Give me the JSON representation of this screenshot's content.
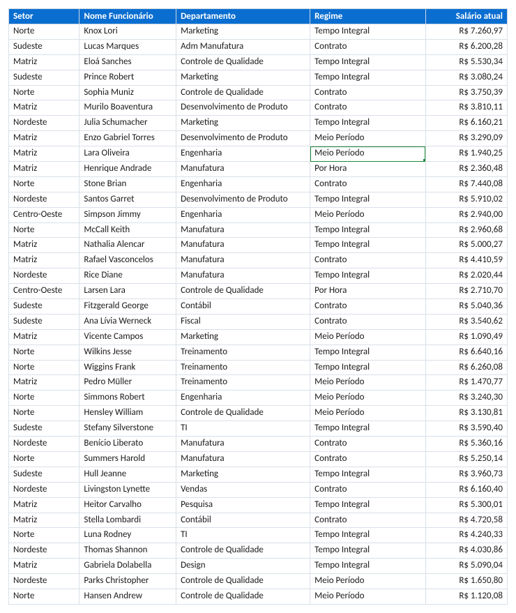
{
  "headers": {
    "setor": "Setor",
    "nome": "Nome Funcionário",
    "departamento": "Departamento",
    "regime": "Regime",
    "salario": "Salário atual"
  },
  "selected_cell": {
    "row_index": 8,
    "col_key": "regime"
  },
  "rows": [
    {
      "setor": "Norte",
      "nome": "Knox Lori",
      "departamento": "Marketing",
      "regime": "Tempo Integral",
      "salario": "R$ 7.260,97"
    },
    {
      "setor": "Sudeste",
      "nome": "Lucas Marques",
      "departamento": "Adm Manufatura",
      "regime": "Contrato",
      "salario": "R$ 6.200,28"
    },
    {
      "setor": "Matriz",
      "nome": "Eloá Sanches",
      "departamento": "Controle de Qualidade",
      "regime": "Tempo Integral",
      "salario": "R$ 5.530,34"
    },
    {
      "setor": "Sudeste",
      "nome": "Prince Robert",
      "departamento": "Marketing",
      "regime": "Tempo Integral",
      "salario": "R$ 3.080,24"
    },
    {
      "setor": "Norte",
      "nome": "Sophia Muniz",
      "departamento": "Controle de Qualidade",
      "regime": "Contrato",
      "salario": "R$ 3.750,39"
    },
    {
      "setor": "Matriz",
      "nome": "Murilo Boaventura",
      "departamento": "Desenvolvimento de Produto",
      "regime": "Contrato",
      "salario": "R$ 3.810,11"
    },
    {
      "setor": "Nordeste",
      "nome": "Julia Schumacher",
      "departamento": "Marketing",
      "regime": "Tempo Integral",
      "salario": "R$ 6.160,21"
    },
    {
      "setor": "Matriz",
      "nome": "Enzo Gabriel Torres",
      "departamento": "Desenvolvimento de Produto",
      "regime": "Meio Período",
      "salario": "R$ 3.290,09"
    },
    {
      "setor": "Matriz",
      "nome": "Lara Oliveira",
      "departamento": "Engenharia",
      "regime": "Meio Período",
      "salario": "R$ 1.940,25"
    },
    {
      "setor": "Matriz",
      "nome": "Henrique Andrade",
      "departamento": "Manufatura",
      "regime": "Por Hora",
      "salario": "R$ 2.360,48"
    },
    {
      "setor": "Norte",
      "nome": "Stone Brian",
      "departamento": "Engenharia",
      "regime": "Contrato",
      "salario": "R$ 7.440,08"
    },
    {
      "setor": "Nordeste",
      "nome": "Santos Garret",
      "departamento": "Desenvolvimento de Produto",
      "regime": "Tempo Integral",
      "salario": "R$ 5.910,02"
    },
    {
      "setor": "Centro-Oeste",
      "nome": "Simpson Jimmy",
      "departamento": "Engenharia",
      "regime": "Meio Período",
      "salario": "R$ 2.940,00"
    },
    {
      "setor": "Norte",
      "nome": "McCall Keith",
      "departamento": "Manufatura",
      "regime": "Tempo Integral",
      "salario": "R$ 2.960,68"
    },
    {
      "setor": "Matriz",
      "nome": "Nathalia Alencar",
      "departamento": "Manufatura",
      "regime": "Tempo Integral",
      "salario": "R$ 5.000,27"
    },
    {
      "setor": "Matriz",
      "nome": "Rafael Vasconcelos",
      "departamento": "Manufatura",
      "regime": "Contrato",
      "salario": "R$ 4.410,59"
    },
    {
      "setor": "Nordeste",
      "nome": "Rice Diane",
      "departamento": "Manufatura",
      "regime": "Tempo Integral",
      "salario": "R$ 2.020,44"
    },
    {
      "setor": "Centro-Oeste",
      "nome": "Larsen Lara",
      "departamento": "Controle de Qualidade",
      "regime": "Por Hora",
      "salario": "R$ 2.710,70"
    },
    {
      "setor": "Sudeste",
      "nome": "Fitzgerald George",
      "departamento": "Contábil",
      "regime": "Contrato",
      "salario": "R$ 5.040,36"
    },
    {
      "setor": "Sudeste",
      "nome": "Ana Lívia Werneck",
      "departamento": "Fiscal",
      "regime": "Contrato",
      "salario": "R$ 3.540,62"
    },
    {
      "setor": "Matriz",
      "nome": "Vicente Campos",
      "departamento": "Marketing",
      "regime": "Meio Período",
      "salario": "R$ 1.090,49"
    },
    {
      "setor": "Norte",
      "nome": "Wilkins Jesse",
      "departamento": "Treinamento",
      "regime": "Tempo Integral",
      "salario": "R$ 6.640,16"
    },
    {
      "setor": "Norte",
      "nome": "Wiggins Frank",
      "departamento": "Treinamento",
      "regime": "Tempo Integral",
      "salario": "R$ 6.260,08"
    },
    {
      "setor": "Matriz",
      "nome": "Pedro Müller",
      "departamento": "Treinamento",
      "regime": "Meio Período",
      "salario": "R$ 1.470,77"
    },
    {
      "setor": "Norte",
      "nome": "Simmons Robert",
      "departamento": "Engenharia",
      "regime": "Meio Período",
      "salario": "R$ 3.240,30"
    },
    {
      "setor": "Norte",
      "nome": "Hensley William",
      "departamento": "Controle de Qualidade",
      "regime": "Meio Período",
      "salario": "R$ 3.130,81"
    },
    {
      "setor": "Sudeste",
      "nome": "Stefany Silverstone",
      "departamento": "TI",
      "regime": "Tempo Integral",
      "salario": "R$ 3.590,40"
    },
    {
      "setor": "Nordeste",
      "nome": "Benício Liberato",
      "departamento": "Manufatura",
      "regime": "Contrato",
      "salario": "R$ 5.360,16"
    },
    {
      "setor": "Norte",
      "nome": "Summers Harold",
      "departamento": "Manufatura",
      "regime": "Contrato",
      "salario": "R$ 5.250,14"
    },
    {
      "setor": "Sudeste",
      "nome": "Hull Jeanne",
      "departamento": "Marketing",
      "regime": "Tempo Integral",
      "salario": "R$ 3.960,73"
    },
    {
      "setor": "Nordeste",
      "nome": "Livingston Lynette",
      "departamento": "Vendas",
      "regime": "Contrato",
      "salario": "R$ 6.160,40"
    },
    {
      "setor": "Matriz",
      "nome": "Heitor Carvalho",
      "departamento": "Pesquisa",
      "regime": "Tempo Integral",
      "salario": "R$ 5.300,01"
    },
    {
      "setor": "Matriz",
      "nome": "Stella Lombardi",
      "departamento": "Contábil",
      "regime": "Contrato",
      "salario": "R$ 4.720,58"
    },
    {
      "setor": "Norte",
      "nome": "Luna Rodney",
      "departamento": "TI",
      "regime": "Tempo Integral",
      "salario": "R$ 4.240,33"
    },
    {
      "setor": "Nordeste",
      "nome": "Thomas Shannon",
      "departamento": "Controle de Qualidade",
      "regime": "Tempo Integral",
      "salario": "R$ 4.030,86"
    },
    {
      "setor": "Matriz",
      "nome": "Gabriela Dolabella",
      "departamento": "Design",
      "regime": "Tempo Integral",
      "salario": "R$ 5.090,04"
    },
    {
      "setor": "Nordeste",
      "nome": "Parks Christopher",
      "departamento": "Controle de Qualidade",
      "regime": "Meio Período",
      "salario": "R$ 1.650,80"
    },
    {
      "setor": "Norte",
      "nome": "Hansen Andrew",
      "departamento": "Controle de Qualidade",
      "regime": "Meio Período",
      "salario": "R$ 1.120,08"
    }
  ]
}
